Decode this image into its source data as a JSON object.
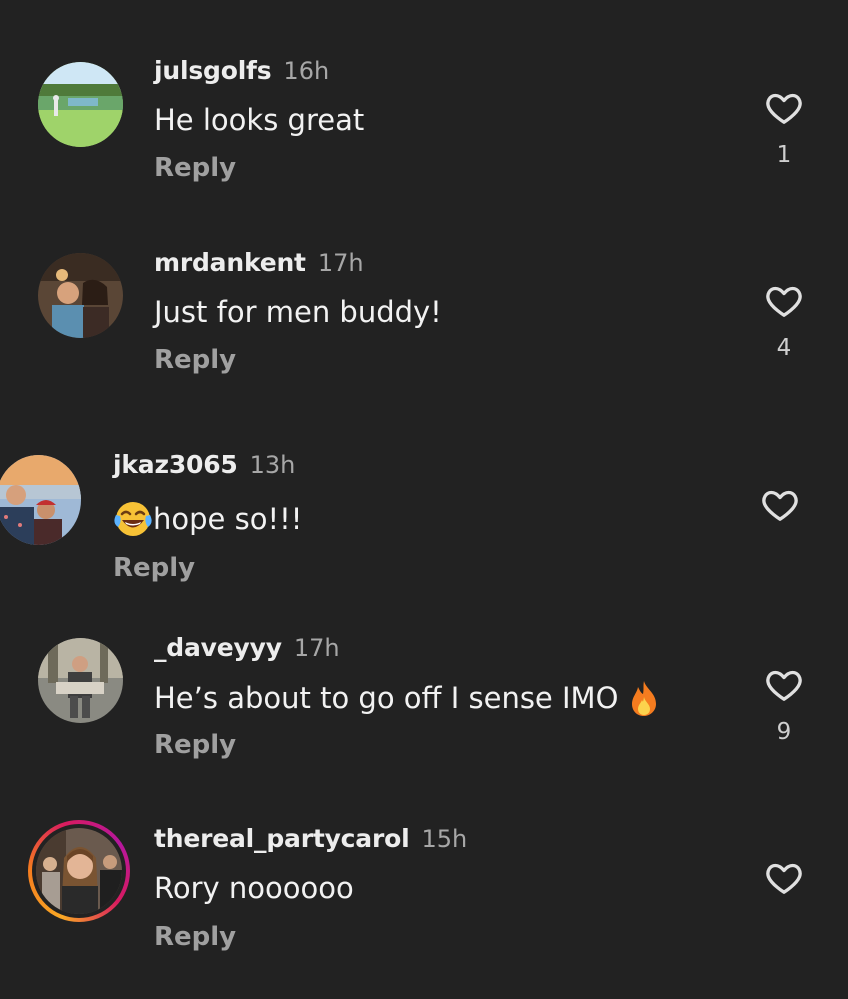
{
  "comments": [
    {
      "username": "julsgolfs",
      "time": "16h",
      "text": "He looks great",
      "reply": "Reply",
      "likes": "1",
      "avatar_icon": "golf-course-photo"
    },
    {
      "username": "mrdankent",
      "time": "17h",
      "text": "Just for men buddy!",
      "reply": "Reply",
      "likes": "4",
      "avatar_icon": "couple-photo"
    },
    {
      "username": "jkaz3065",
      "time": "13h",
      "text": "hope so!!!",
      "emoji_prefix": "face-with-tears-of-joy",
      "reply": "Reply",
      "likes": "",
      "avatar_icon": "sunset-couple-photo"
    },
    {
      "username": "_daveyyy",
      "time": "17h",
      "text": "He’s about to go off I sense IMO ",
      "emoji_suffix": "fire",
      "reply": "Reply",
      "likes": "9",
      "avatar_icon": "outdoor-photo"
    },
    {
      "username": "thereal_partycarol",
      "time": "15h",
      "text": "Rory noooooo",
      "reply": "Reply",
      "likes": "",
      "avatar_icon": "woman-portrait-photo",
      "story_ring": true
    }
  ],
  "colors": {
    "background": "#222222",
    "text": "#f2f2f2",
    "muted": "#a0a0a0",
    "story_ring_start": "#f9a825",
    "story_ring_end": "#d81b60"
  }
}
